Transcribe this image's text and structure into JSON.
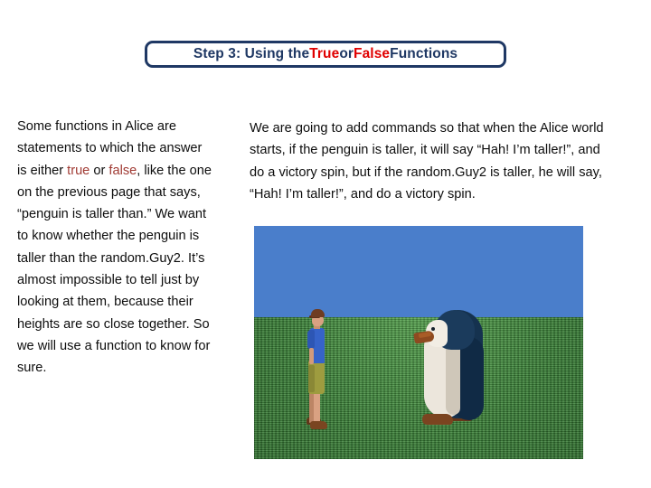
{
  "title": {
    "segments": [
      {
        "text": "Step 3: Using the ",
        "style": "navy"
      },
      {
        "text": "True",
        "style": "red"
      },
      {
        "text": " or ",
        "style": "navy"
      },
      {
        "text": "False",
        "style": "red"
      },
      {
        "text": " Functions",
        "style": "navy"
      }
    ],
    "full_text": "Step 3: Using the True or False Functions",
    "border_color": "#1F3864",
    "text_color": "#1F3864",
    "accent_color": "#E00000"
  },
  "left_column": {
    "runs": [
      {
        "text": "Some functions in Alice are statements to which the answer is either ",
        "style": "normal"
      },
      {
        "text": "true",
        "style": "keyword"
      },
      {
        "text": " or ",
        "style": "normal"
      },
      {
        "text": "false",
        "style": "keyword"
      },
      {
        "text": ", like the one on the previous page that says, “penguin is taller than.” We want to know whether the penguin is taller than the random.Guy2. It’s almost impossible to tell just by looking at them, because their heights are so close together. So we will use a function to know for sure.",
        "style": "normal"
      }
    ],
    "keyword_color": "#A03A33",
    "text_color": "#0D0D0D"
  },
  "right_column": {
    "paragraph": "We are going to add commands so that when the Alice world starts, if the penguin is taller, it will say “Hah! I’m taller!”, and do a victory spin, but if the random.Guy2 is taller, he will say, “Hah! I’m taller!”, and do a victory spin.",
    "text_color": "#0D0D0D"
  },
  "scene_image": {
    "description": "Alice 3D world screenshot: a man and a penguin standing on green grass under a blue sky",
    "sky_color": "#4A7ECB",
    "ground_color": "#3E8A3C",
    "characters": [
      {
        "name": "randomGuy2",
        "shirt_color": "#3663C9",
        "shorts_color": "#9E9C3F",
        "hair_color": "#6E3C22",
        "skin_color": "#D9A182",
        "shoe_color": "#7A4520"
      },
      {
        "name": "penguin",
        "back_color": "#15324F",
        "belly_color": "#ECE6DC",
        "beak_color": "#8E4A20",
        "foot_color": "#7B4420"
      }
    ]
  }
}
